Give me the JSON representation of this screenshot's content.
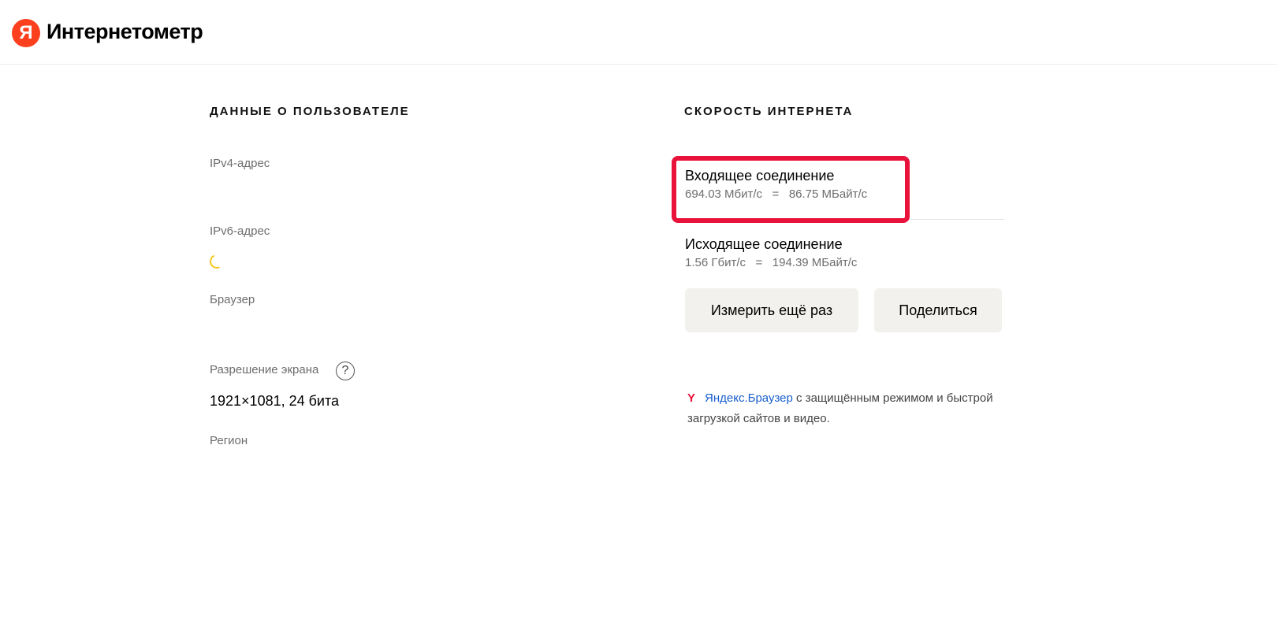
{
  "header": {
    "logo_letter": "Я",
    "title": "Интернетометр"
  },
  "user_section": {
    "title": "ДАННЫЕ О ПОЛЬЗОВАТЕЛЕ",
    "ipv4_label": "IPv4-адрес",
    "ipv6_label": "IPv6-адрес",
    "browser_label": "Браузер",
    "resolution_label": "Разрешение экрана",
    "resolution_help_icon": "?",
    "resolution_value": "1921×1081, 24 бита",
    "region_label": "Регион"
  },
  "speed_section": {
    "title": "СКОРОСТЬ ИНТЕРНЕТА",
    "incoming": {
      "title": "Входящее соединение",
      "value": "694.03 Мбит/с   =   86.75 МБайт/с"
    },
    "outgoing": {
      "title": "Исходящее соединение",
      "value": "1.56 Гбит/с   =   194.39 МБайт/с"
    },
    "measure_again_label": "Измерить ещё раз",
    "share_label": "Поделиться"
  },
  "promo": {
    "icon": "Y",
    "link_text": "Яндекс.Браузер",
    "text": " с защищённым режимом и быстрой загрузкой сайтов и видео."
  },
  "colors": {
    "brand_red": "#fc3f1d",
    "highlight": "#e8123a",
    "link": "#1a5fcf",
    "spinner": "#f5c71a",
    "button_bg": "#f3f1ed"
  }
}
